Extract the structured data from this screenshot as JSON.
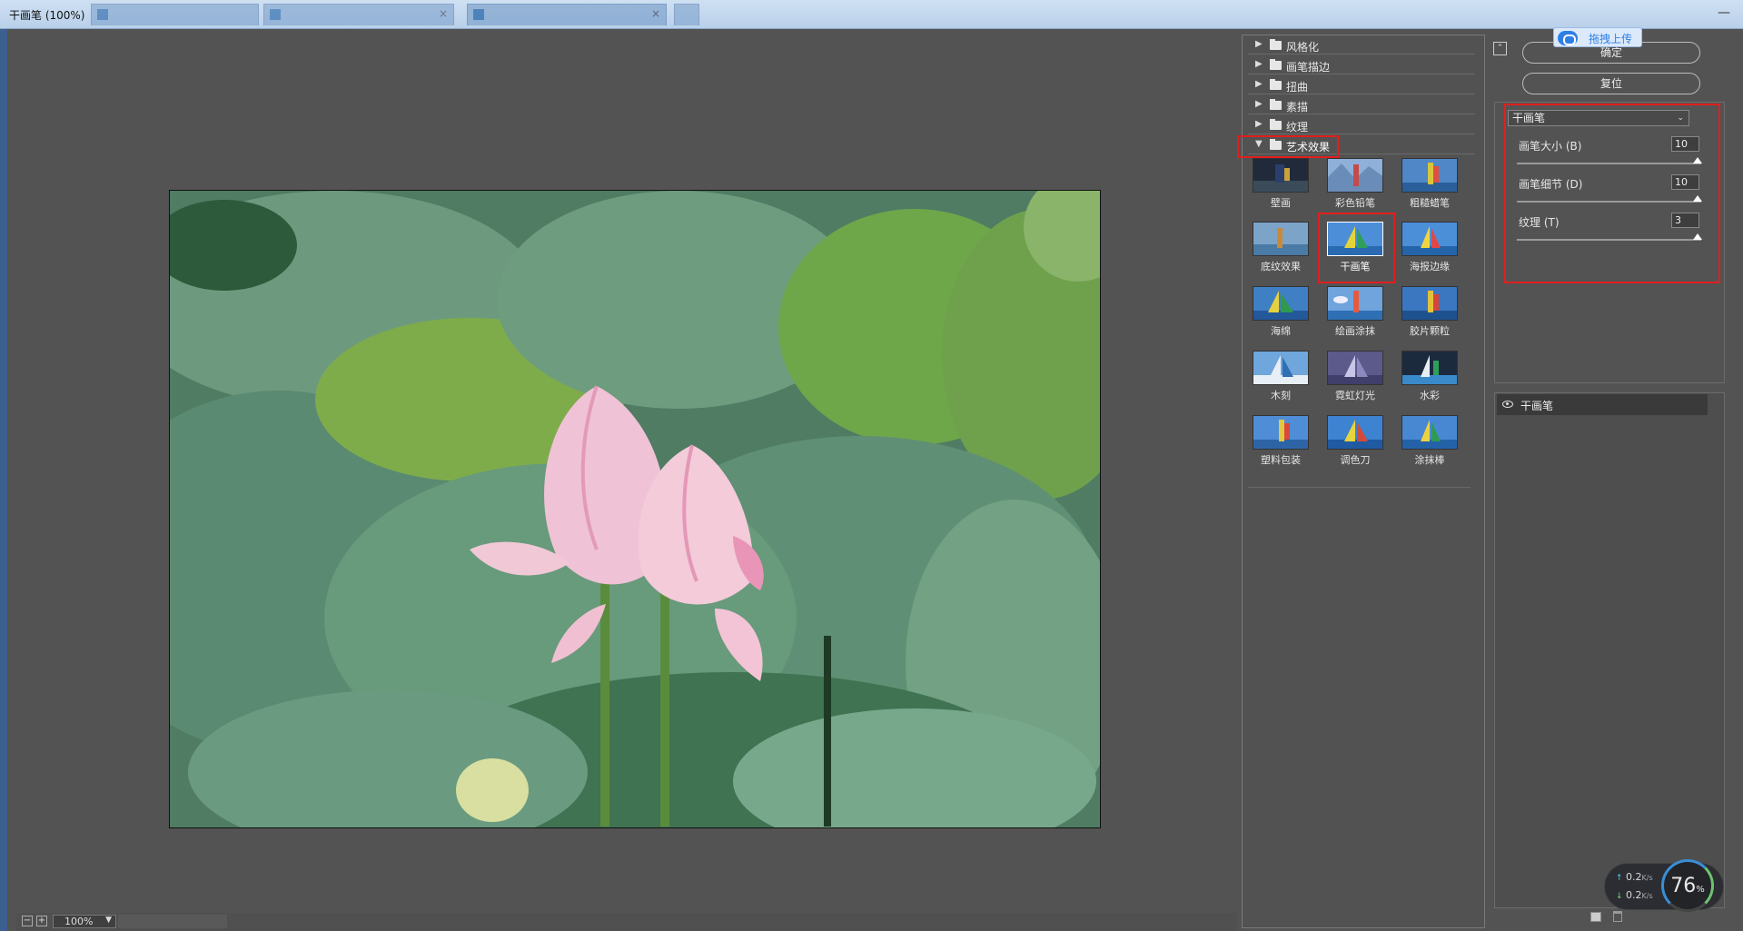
{
  "window": {
    "title": "干画笔 (100%)"
  },
  "canvas": {
    "zoom": "100%"
  },
  "gallery": {
    "categories": [
      {
        "label": "风格化",
        "expanded": false
      },
      {
        "label": "画笔描边",
        "expanded": false
      },
      {
        "label": "扭曲",
        "expanded": false
      },
      {
        "label": "素描",
        "expanded": false
      },
      {
        "label": "纹理",
        "expanded": false
      },
      {
        "label": "艺术效果",
        "expanded": true
      }
    ],
    "filters": [
      {
        "label": "壁画"
      },
      {
        "label": "彩色铅笔"
      },
      {
        "label": "粗糙蜡笔"
      },
      {
        "label": "底纹效果"
      },
      {
        "label": "干画笔",
        "selected": true
      },
      {
        "label": "海报边缘"
      },
      {
        "label": "海绵"
      },
      {
        "label": "绘画涂抹"
      },
      {
        "label": "胶片颗粒"
      },
      {
        "label": "木刻"
      },
      {
        "label": "霓虹灯光"
      },
      {
        "label": "水彩"
      },
      {
        "label": "塑料包装"
      },
      {
        "label": "调色刀"
      },
      {
        "label": "涂抹棒"
      }
    ]
  },
  "settings": {
    "ok_label": "确定",
    "reset_label": "复位",
    "selected_filter": "干画笔",
    "params": [
      {
        "label": "画笔大小 (B)",
        "value": "10",
        "level": 1.0
      },
      {
        "label": "画笔细节 (D)",
        "value": "10",
        "level": 1.0
      },
      {
        "label": "纹理 (T)",
        "value": "3",
        "level": 1.0
      }
    ]
  },
  "layers": {
    "items": [
      {
        "label": "干画笔",
        "visible": true
      }
    ]
  },
  "upload_badge": {
    "label": "拖拽上传"
  },
  "network": {
    "upload_speed": "0.2",
    "download_speed": "0.2",
    "unit": "K/s",
    "gauge_value": "76",
    "gauge_unit": "%"
  },
  "colors": {
    "highlight_red": "#e21e1e",
    "panel_bg": "#535353",
    "accent_blue": "#2f7fe6"
  }
}
